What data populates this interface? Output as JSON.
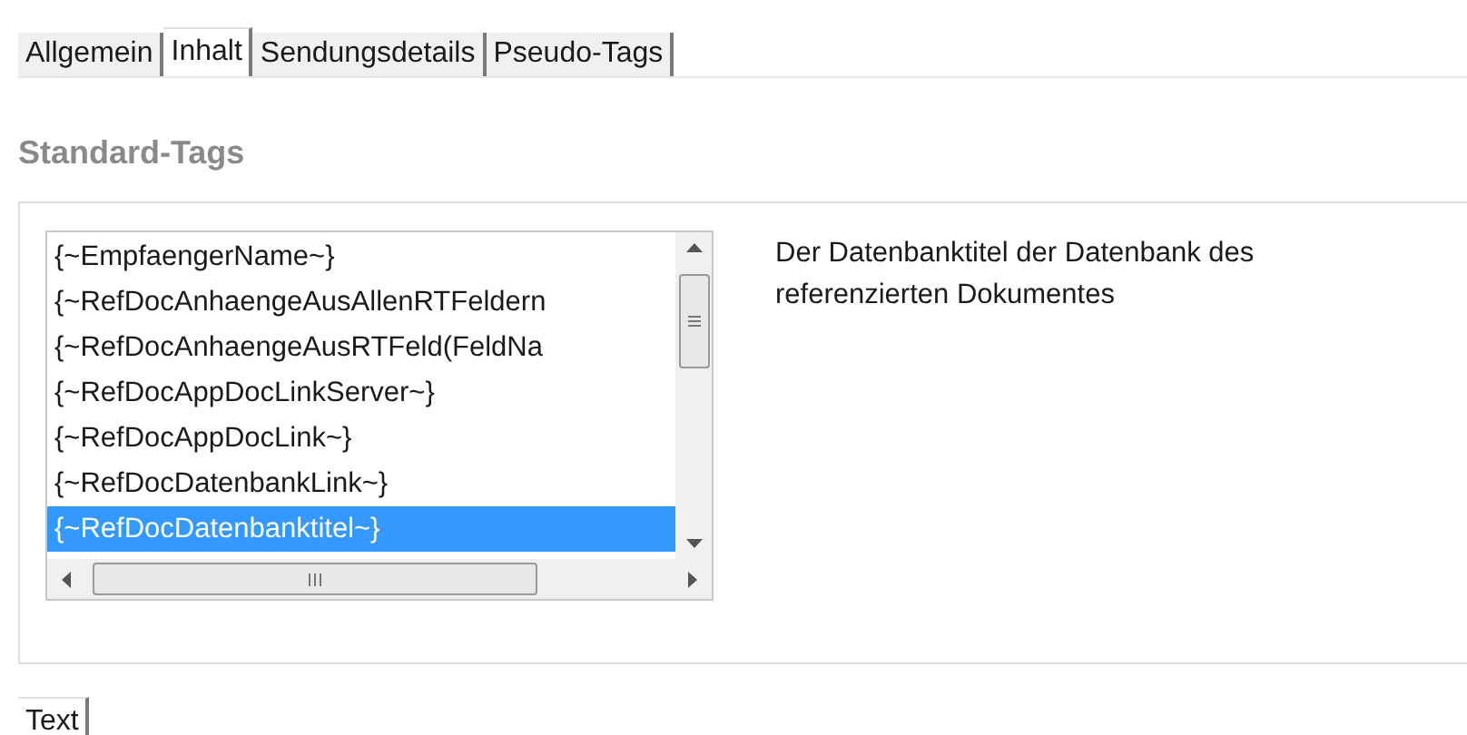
{
  "tabs": [
    {
      "label": "Allgemein",
      "selected": false
    },
    {
      "label": "Inhalt",
      "selected": true
    },
    {
      "label": "Sendungsdetails",
      "selected": false
    },
    {
      "label": "Pseudo-Tags",
      "selected": false
    }
  ],
  "section_title": "Standard-Tags",
  "tag_list": {
    "items": [
      {
        "label": "{~EmpfaengerName~}",
        "selected": false
      },
      {
        "label": "{~RefDocAnhaengeAusAllenRTFeldern",
        "selected": false
      },
      {
        "label": "{~RefDocAnhaengeAusRTFeld(FeldNa",
        "selected": false
      },
      {
        "label": "{~RefDocAppDocLinkServer~}",
        "selected": false
      },
      {
        "label": "{~RefDocAppDocLink~}",
        "selected": false
      },
      {
        "label": "{~RefDocDatenbankLink~}",
        "selected": false
      },
      {
        "label": "{~RefDocDatenbanktitel~}",
        "selected": true
      }
    ]
  },
  "description": "Der Datenbanktitel der Datenbank des referenzierten Dokumentes",
  "bottom_tabs": [
    {
      "label": "Text",
      "selected": true
    }
  ]
}
